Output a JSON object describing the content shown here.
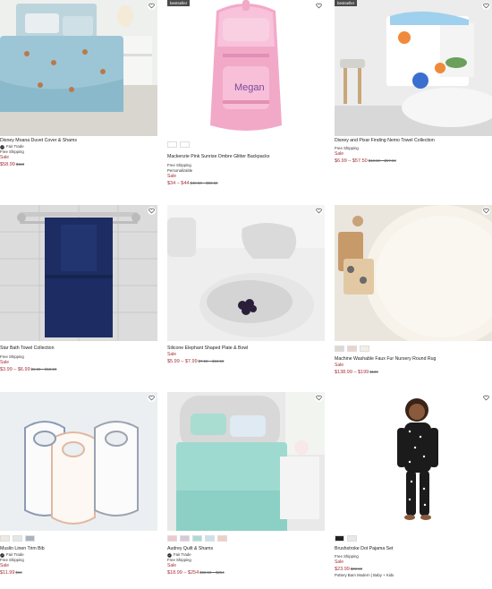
{
  "icons": {
    "favorite": "heart-outline-icon",
    "fair_trade": "fair-trade-icon"
  },
  "colors": {
    "sale": "#a4303a",
    "badge_bg": "#4a4a4a"
  },
  "products": [
    {
      "title": "Disney Moana Duvet Cover & Shams",
      "fair_trade": "Fair Trade",
      "shipping": "Free Shipping",
      "sale_label": "Sale",
      "price": "$58.99",
      "original_price": "$118"
    },
    {
      "badge": "bestseller",
      "title": "Mackenzie Pink Sunrise Ombre Glitter Backpacks",
      "shipping": "Free Shipping",
      "personalize": "Personalizable",
      "sale_label": "Sale",
      "price": "$34 – $44",
      "original_price": "$49.50 – $59.50",
      "monogram": "Megan"
    },
    {
      "badge": "bestseller",
      "title": "Disney and Pixar Finding Nemo Towel Collection",
      "shipping": "Free Shipping",
      "sale_label": "Sale",
      "price": "$6.99 – $57.50",
      "original_price": "$18.50 – $97.50"
    },
    {
      "title": "Star Bath Towel Collection",
      "shipping": "Free Shipping",
      "sale_label": "Sale",
      "price": "$3.99 – $6.99",
      "original_price": "$6.50 – $18.50"
    },
    {
      "title": "Silicone Elephant Shaped Plate & Bowl",
      "sale_label": "Sale",
      "price": "$5.99 – $7.99",
      "original_price": "$7.50 – $10.50"
    },
    {
      "title": "Machine Washable Faux Fur Nursery Round Rug",
      "sale_label": "Sale",
      "price": "$138.99 – $199",
      "original_price": "$199"
    },
    {
      "title": "Muslin Linen Trim Bib",
      "fair_trade": "Fair Trade",
      "shipping": "Free Shipping",
      "sale_label": "Sale",
      "price": "$11.99",
      "original_price": "$16"
    },
    {
      "title": "Audrey Quilt & Shams",
      "fair_trade": "Fair Trade",
      "shipping": "Free Shipping",
      "sale_label": "Sale",
      "price": "$18.99 – $254",
      "original_price": "$32.50 – $254"
    },
    {
      "title": "Brushstroke Dot Pajama Set",
      "shipping": "Free Shipping",
      "sale_label": "Sale",
      "price": "$23.99",
      "original_price": "$39.50",
      "brand_note": "Pottery Barn Modern | Baby + Kids"
    }
  ]
}
